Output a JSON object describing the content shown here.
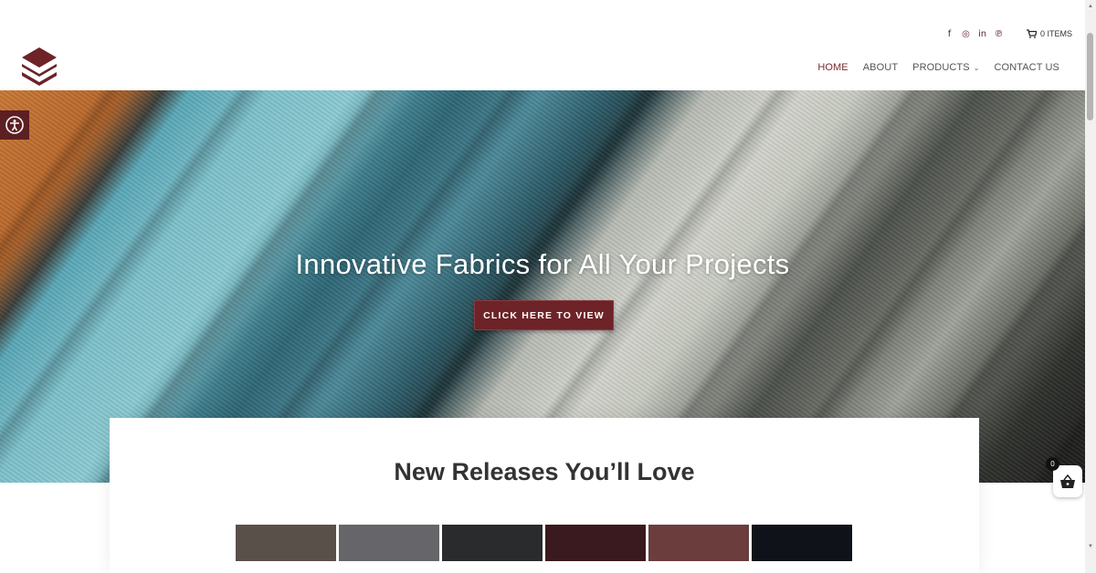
{
  "header": {
    "social": [
      {
        "name": "facebook-icon",
        "glyph": "f"
      },
      {
        "name": "instagram-icon",
        "glyph": "◎"
      },
      {
        "name": "linkedin-icon",
        "glyph": "in"
      },
      {
        "name": "pinterest-icon",
        "glyph": "℗"
      }
    ],
    "cart_label": "0 ITEMS",
    "nav": {
      "home": "HOME",
      "about": "ABOUT",
      "products": "PRODUCTS",
      "contact": "CONTACT US"
    }
  },
  "hero": {
    "title": "Innovative Fabrics for All Your Projects",
    "button": "CLICK HERE TO VIEW"
  },
  "releases": {
    "title": "New Releases You’ll Love",
    "swatches": [
      "#5a504a",
      "#66666a",
      "#2a2b2c",
      "#3a1a1e",
      "#6b3d3d",
      "#0f1218"
    ]
  },
  "floating_cart": {
    "count": "0"
  },
  "colors": {
    "brand": "#6d2328",
    "accent_nav": "#7a2a2f"
  }
}
